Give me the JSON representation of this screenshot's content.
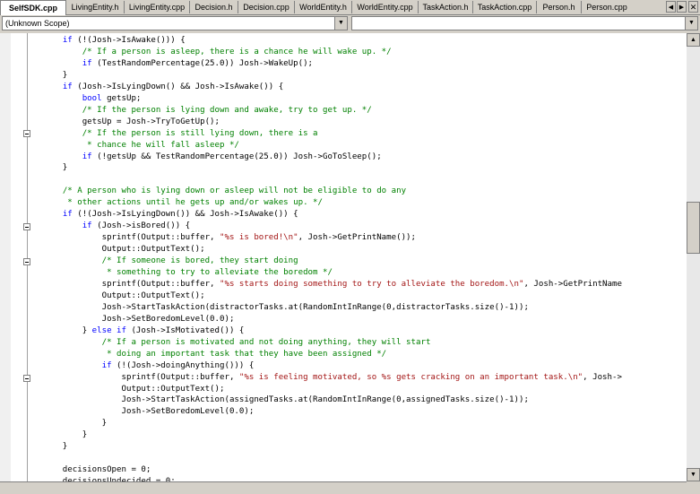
{
  "tabs": [
    "SelfSDK.cpp",
    "LivingEntity.h",
    "LivingEntity.cpp",
    "Decision.h",
    "Decision.cpp",
    "WorldEntity.h",
    "WorldEntity.cpp",
    "TaskAction.h",
    "TaskAction.cpp",
    "Person.h",
    "Person.cpp"
  ],
  "active_tab": "SelfSDK.cpp",
  "scope": {
    "left_value": "(Unknown Scope)",
    "right_value": ""
  },
  "code_lines": [
    [
      [
        "p",
        "        "
      ],
      [
        "k",
        "if"
      ],
      [
        "p",
        " (!(Josh->IsAwake())) {"
      ]
    ],
    [
      [
        "p",
        "            "
      ],
      [
        "c",
        "/* If a person is asleep, there is a chance he will wake up. */"
      ]
    ],
    [
      [
        "p",
        "            "
      ],
      [
        "k",
        "if"
      ],
      [
        "p",
        " (TestRandomPercentage(25.0)) Josh->WakeUp();"
      ]
    ],
    [
      [
        "p",
        "        }"
      ]
    ],
    [
      [
        "p",
        "        "
      ],
      [
        "k",
        "if"
      ],
      [
        "p",
        " (Josh->IsLyingDown() && Josh->IsAwake()) {"
      ]
    ],
    [
      [
        "p",
        "            "
      ],
      [
        "k",
        "bool"
      ],
      [
        "p",
        " getsUp;"
      ]
    ],
    [
      [
        "p",
        "            "
      ],
      [
        "c",
        "/* If the person is lying down and awake, try to get up. */"
      ]
    ],
    [
      [
        "p",
        "            getsUp = Josh->TryToGetUp();"
      ]
    ],
    [
      [
        "p",
        "            "
      ],
      [
        "c",
        "/* If the person is still lying down, there is a"
      ]
    ],
    [
      [
        "c",
        "             * chance he will fall asleep */"
      ]
    ],
    [
      [
        "p",
        "            "
      ],
      [
        "k",
        "if"
      ],
      [
        "p",
        " (!getsUp && TestRandomPercentage(25.0)) Josh->GoToSleep();"
      ]
    ],
    [
      [
        "p",
        "        }"
      ]
    ],
    [
      [
        "p",
        ""
      ]
    ],
    [
      [
        "p",
        "        "
      ],
      [
        "c",
        "/* A person who is lying down or asleep will not be eligible to do any"
      ]
    ],
    [
      [
        "c",
        "         * other actions until he gets up and/or wakes up. */"
      ]
    ],
    [
      [
        "p",
        "        "
      ],
      [
        "k",
        "if"
      ],
      [
        "p",
        " (!(Josh->IsLyingDown()) && Josh->IsAwake()) {"
      ]
    ],
    [
      [
        "p",
        "            "
      ],
      [
        "k",
        "if"
      ],
      [
        "p",
        " (Josh->isBored()) {"
      ]
    ],
    [
      [
        "p",
        "                sprintf(Output::buffer, "
      ],
      [
        "s",
        "\"%s is bored!\\n\""
      ],
      [
        "p",
        ", Josh->GetPrintName());"
      ]
    ],
    [
      [
        "p",
        "                Output::OutputText();"
      ]
    ],
    [
      [
        "p",
        "                "
      ],
      [
        "c",
        "/* If someone is bored, they start doing"
      ]
    ],
    [
      [
        "c",
        "                 * something to try to alleviate the boredom */"
      ]
    ],
    [
      [
        "p",
        "                sprintf(Output::buffer, "
      ],
      [
        "s",
        "\"%s starts doing something to try to alleviate the boredom.\\n\""
      ],
      [
        "p",
        ", Josh->GetPrintName"
      ]
    ],
    [
      [
        "p",
        "                Output::OutputText();"
      ]
    ],
    [
      [
        "p",
        "                Josh->StartTaskAction(distractorTasks.at(RandomIntInRange(0,distractorTasks.size()-1));"
      ]
    ],
    [
      [
        "p",
        "                Josh->SetBoredomLevel(0.0);"
      ]
    ],
    [
      [
        "p",
        "            } "
      ],
      [
        "k",
        "else if"
      ],
      [
        "p",
        " (Josh->IsMotivated()) {"
      ]
    ],
    [
      [
        "p",
        "                "
      ],
      [
        "c",
        "/* If a person is motivated and not doing anything, they will start"
      ]
    ],
    [
      [
        "c",
        "                 * doing an important task that they have been assigned */"
      ]
    ],
    [
      [
        "p",
        "                "
      ],
      [
        "k",
        "if"
      ],
      [
        "p",
        " (!(Josh->doingAnything())) {"
      ]
    ],
    [
      [
        "p",
        "                    sprintf(Output::buffer, "
      ],
      [
        "s",
        "\"%s is feeling motivated, so %s gets cracking on an important task.\\n\""
      ],
      [
        "p",
        ", Josh->"
      ]
    ],
    [
      [
        "p",
        "                    Output::OutputText();"
      ]
    ],
    [
      [
        "p",
        "                    Josh->StartTaskAction(assignedTasks.at(RandomIntInRange(0,assignedTasks.size()-1));"
      ]
    ],
    [
      [
        "p",
        "                    Josh->SetBoredomLevel(0.0);"
      ]
    ],
    [
      [
        "p",
        "                }"
      ]
    ],
    [
      [
        "p",
        "            }"
      ]
    ],
    [
      [
        "p",
        "        }"
      ]
    ],
    [
      [
        "p",
        ""
      ]
    ],
    [
      [
        "p",
        "        decisionsOpen = 0;"
      ]
    ],
    [
      [
        "p",
        "        decisionsUndecided = 0;"
      ]
    ]
  ],
  "icons": {
    "left_arrow": "left-arrow-icon",
    "right_arrow": "right-arrow-icon",
    "close": "close-icon",
    "dropdown": "dropdown-arrow-icon"
  }
}
